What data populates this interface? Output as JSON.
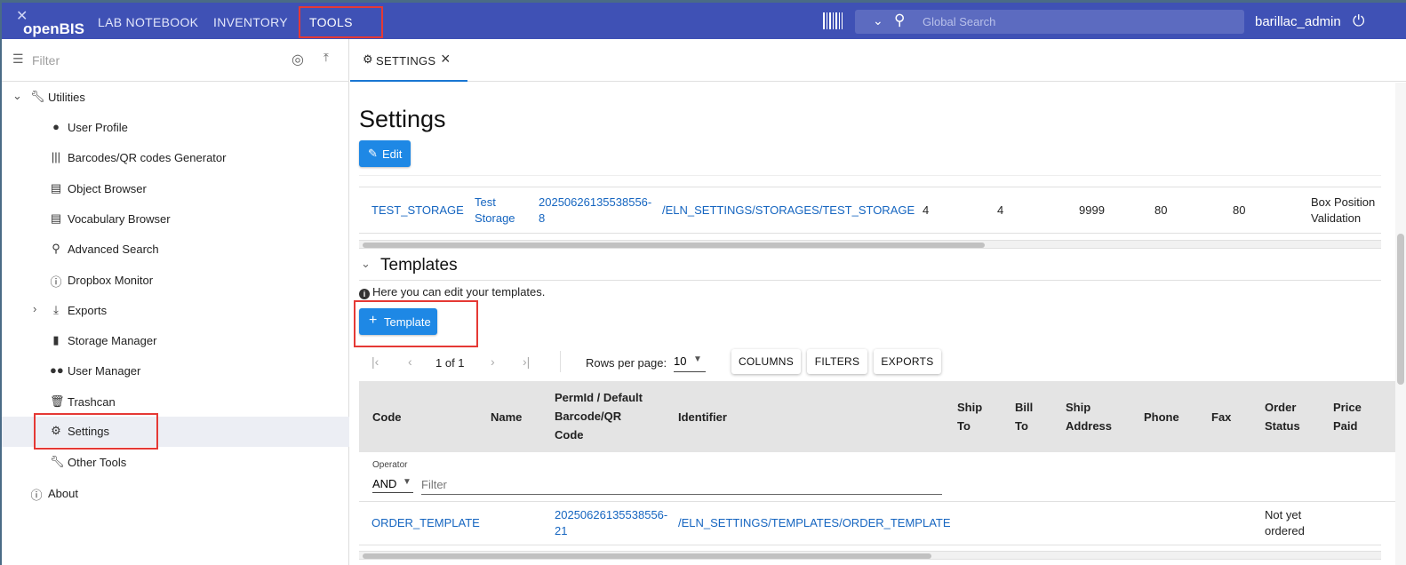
{
  "header": {
    "logo_text": "openBIS",
    "nav": [
      "LAB NOTEBOOK",
      "INVENTORY",
      "TOOLS"
    ],
    "search_placeholder": "Global Search",
    "user": "barillac_admin",
    "colors": {
      "topbar": "#3f51b5",
      "search": "#5c6bc0",
      "highlight": "#e53935"
    }
  },
  "sidebar": {
    "filter_placeholder": "Filter",
    "root": {
      "label": "Utilities",
      "icon": "wrench-icon"
    },
    "items": [
      {
        "label": "User Profile",
        "icon": "person-icon"
      },
      {
        "label": "Barcodes/QR codes Generator",
        "icon": "barcode-icon"
      },
      {
        "label": "Object Browser",
        "icon": "table-icon"
      },
      {
        "label": "Vocabulary Browser",
        "icon": "table-icon"
      },
      {
        "label": "Advanced Search",
        "icon": "search-icon"
      },
      {
        "label": "Dropbox Monitor",
        "icon": "info-icon"
      },
      {
        "label": "Exports",
        "icon": "export-icon"
      },
      {
        "label": "Storage Manager",
        "icon": "file-icon"
      },
      {
        "label": "User Manager",
        "icon": "group-icon"
      },
      {
        "label": "Trashcan",
        "icon": "trash-icon"
      },
      {
        "label": "Settings",
        "icon": "gear-icon"
      },
      {
        "label": "Other Tools",
        "icon": "wrench-icon"
      }
    ],
    "about": {
      "label": "About",
      "icon": "info-icon"
    }
  },
  "tab": {
    "label": "SETTINGS"
  },
  "page": {
    "title": "Settings",
    "edit_label": "Edit"
  },
  "storage_row": {
    "code": "TEST_STORAGE",
    "name_line1": "Test",
    "name_line2": "Storage",
    "permid_line1": "20250626135538556-",
    "permid_line2": "8",
    "identifier": "/ELN_SETTINGS/STORAGES/TEST_STORAGE",
    "v1": "4",
    "v2": "4",
    "v3": "9999",
    "v4": "80",
    "v5": "80",
    "validation_line1": "Box Position",
    "validation_line2": "Validation"
  },
  "templates": {
    "title": "Templates",
    "info": "Here you can edit your templates.",
    "add_label": "Template",
    "pager": {
      "page_text": "1 of 1",
      "rows_label": "Rows per page:",
      "rows_value": "10",
      "buttons": [
        "COLUMNS",
        "FILTERS",
        "EXPORTS"
      ]
    },
    "columns": {
      "code": "Code",
      "name": "Name",
      "permid_1": "PermId / Default",
      "permid_2": "Barcode/QR",
      "permid_3": "Code",
      "identifier": "Identifier",
      "ship_to_1": "Ship",
      "ship_to_2": "To",
      "bill_to_1": "Bill",
      "bill_to_2": "To",
      "ship_addr_1": "Ship",
      "ship_addr_2": "Address",
      "phone": "Phone",
      "fax": "Fax",
      "order_status_1": "Order",
      "order_status_2": "Status",
      "price_paid_1": "Price",
      "price_paid_2": "Paid"
    },
    "operator_label": "Operator",
    "operator_value": "AND",
    "filter_placeholder": "Filter",
    "rows": [
      {
        "code": "ORDER_TEMPLATE",
        "permid_line1": "20250626135538556-",
        "permid_line2": "21",
        "identifier": "/ELN_SETTINGS/TEMPLATES/ORDER_TEMPLATE",
        "status_line1": "Not yet",
        "status_line2": "ordered"
      }
    ]
  }
}
